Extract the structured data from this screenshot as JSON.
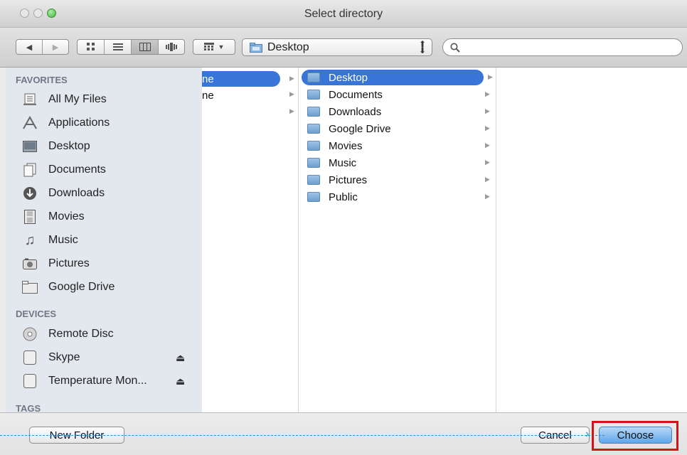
{
  "window": {
    "title": "Select directory"
  },
  "toolbar": {
    "back_icon": "back-arrow-icon",
    "forward_icon": "forward-arrow-icon",
    "view_icons": [
      "icon-view-icon",
      "list-view-icon",
      "column-view-icon",
      "coverflow-view-icon"
    ],
    "arrange_icon": "arrange-grid-icon",
    "location": "Desktop",
    "search_placeholder": ""
  },
  "sidebar": {
    "favorites_header": "FAVORITES",
    "favorites": [
      {
        "label": "All My Files",
        "icon": "all-files-icon"
      },
      {
        "label": "Applications",
        "icon": "applications-icon"
      },
      {
        "label": "Desktop",
        "icon": "desktop-icon"
      },
      {
        "label": "Documents",
        "icon": "documents-icon"
      },
      {
        "label": "Downloads",
        "icon": "downloads-icon"
      },
      {
        "label": "Movies",
        "icon": "movies-icon"
      },
      {
        "label": "Music",
        "icon": "music-icon"
      },
      {
        "label": "Pictures",
        "icon": "pictures-icon"
      },
      {
        "label": "Google Drive",
        "icon": "folder-icon"
      }
    ],
    "devices_header": "DEVICES",
    "devices": [
      {
        "label": "Remote Disc",
        "icon": "disc-icon"
      },
      {
        "label": "Skype",
        "icon": "drive-icon"
      },
      {
        "label": "Temperature Mon...",
        "icon": "drive-icon"
      }
    ],
    "tags_header": "TAGS"
  },
  "columns": {
    "col1": [
      {
        "label": "ne",
        "selected": true
      },
      {
        "label": "ne",
        "selected": false
      }
    ],
    "col2": [
      {
        "label": "Desktop",
        "selected": true
      },
      {
        "label": "Documents",
        "selected": false
      },
      {
        "label": "Downloads",
        "selected": false
      },
      {
        "label": "Google Drive",
        "selected": false
      },
      {
        "label": "Movies",
        "selected": false
      },
      {
        "label": "Music",
        "selected": false
      },
      {
        "label": "Pictures",
        "selected": false
      },
      {
        "label": "Public",
        "selected": false
      }
    ]
  },
  "buttons": {
    "new_folder": "New Folder",
    "cancel": "Cancel",
    "choose": "Choose"
  },
  "colors": {
    "selection": "#3875d7",
    "highlight": "#d0141c",
    "annotation_line": "#2a8fd6"
  }
}
